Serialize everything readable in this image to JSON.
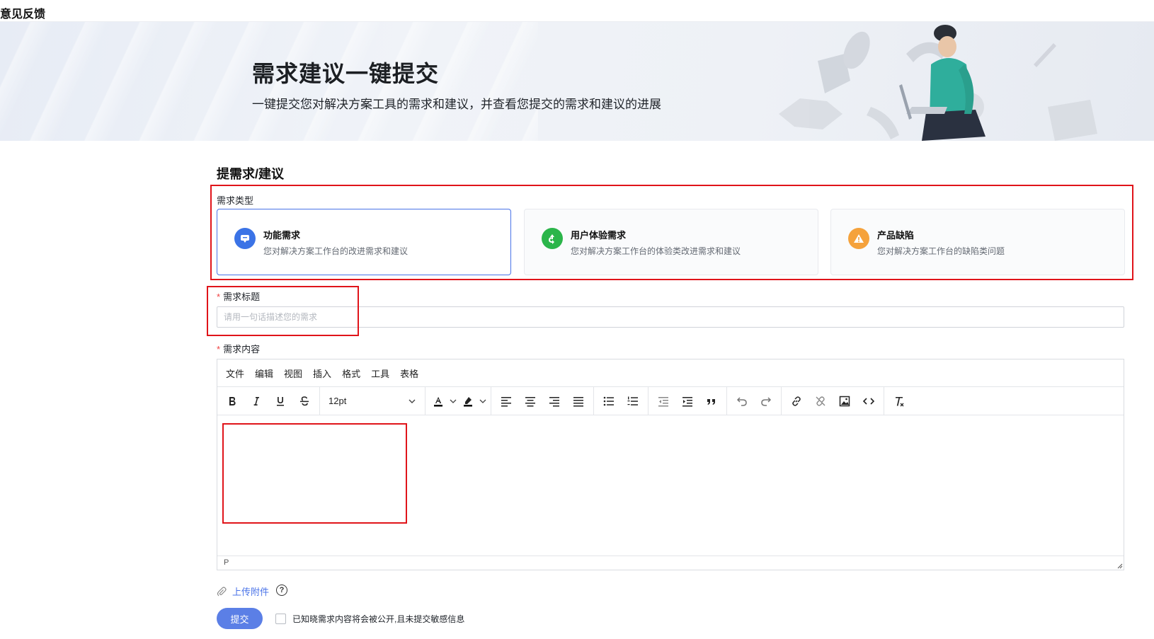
{
  "page": {
    "title": "意见反馈"
  },
  "banner": {
    "title": "需求建议一键提交",
    "subtitle": "一键提交您对解决方案工具的需求和建议，并查看您提交的需求和建议的进展"
  },
  "form": {
    "section_title": "提需求/建议",
    "type_label": "需求类型",
    "types": [
      {
        "title": "功能需求",
        "desc": "您对解决方案工作台的改进需求和建议",
        "icon": "message-icon",
        "color": "#3b73e6",
        "selected": true
      },
      {
        "title": "用户体验需求",
        "desc": "您对解决方案工作台的体验类改进需求和建议",
        "icon": "recycle-icon",
        "color": "#2bb54a",
        "selected": false
      },
      {
        "title": "产品缺陷",
        "desc": "您对解决方案工作台的缺陷类问题",
        "icon": "warning-icon",
        "color": "#f5a23c",
        "selected": false
      }
    ],
    "title_label": "需求标题",
    "title_required_mark": "*",
    "title_placeholder": "请用一句话描述您的需求",
    "title_value": "",
    "content_label": "需求内容",
    "content_required_mark": "*"
  },
  "editor": {
    "menus": [
      "文件",
      "编辑",
      "视图",
      "插入",
      "格式",
      "工具",
      "表格"
    ],
    "font_size": "12pt",
    "status_path": "P",
    "content": ""
  },
  "footer": {
    "upload_label": "上传附件",
    "help_symbol": "?",
    "submit_label": "提交",
    "agree_text": "已知晓需求内容将会被公开,且未提交敏感信息",
    "agree_checked": false
  },
  "colors": {
    "accent": "#4a73e8",
    "annotation": "#e0141a"
  }
}
